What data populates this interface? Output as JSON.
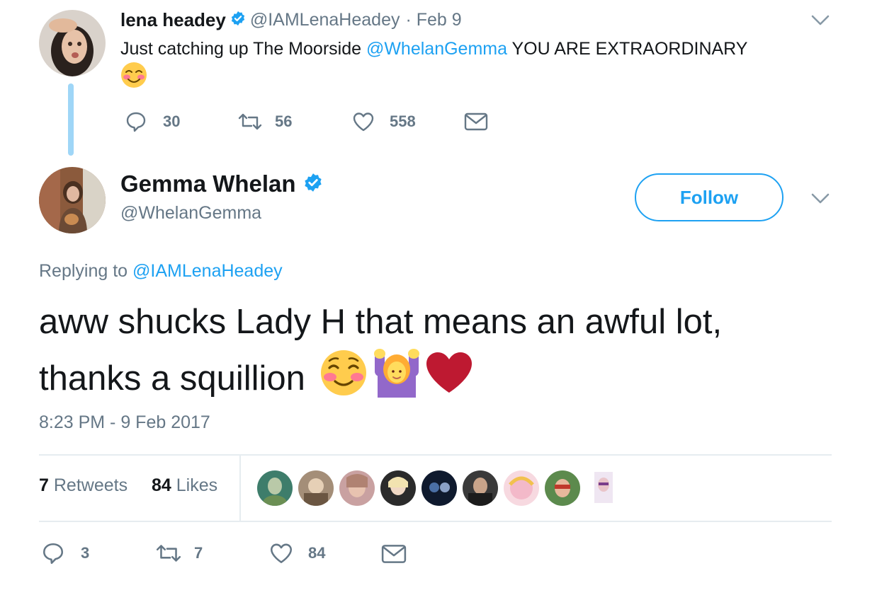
{
  "parent_tweet": {
    "author_name": "lena headey",
    "author_handle": "@IAMLenaHeadey",
    "date": "· Feb 9",
    "text_before": "Just catching up The Moorside ",
    "mention": "@WhelanGemma",
    "text_after": " YOU ARE EXTRAORDINARY",
    "emoji": "smiling-face-with-blush",
    "reply_count": "30",
    "retweet_count": "56",
    "like_count": "558"
  },
  "main_tweet": {
    "author_name": "Gemma Whelan",
    "author_handle": "@WhelanGemma",
    "follow_label": "Follow",
    "replying_prefix": "Replying to ",
    "replying_handle": "@IAMLenaHeadey",
    "text_line1": "aww shucks Lady H that means an awful lot,",
    "text_line2": "thanks a squillion",
    "emojis": [
      "smiling-face-with-closed-eyes",
      "person-raising-hands",
      "red-heart"
    ],
    "timestamp": "8:23 PM - 9 Feb 2017",
    "retweets_number": "7",
    "retweets_label": "Retweets",
    "likes_number": "84",
    "likes_label": "Likes",
    "reply_count": "3",
    "retweet_count": "7",
    "like_count": "84"
  },
  "colors": {
    "accent": "#1da1f2",
    "muted": "#657786",
    "text": "#14171a",
    "divider": "#e6ecf0",
    "thread_line": "#9fd6f7"
  }
}
